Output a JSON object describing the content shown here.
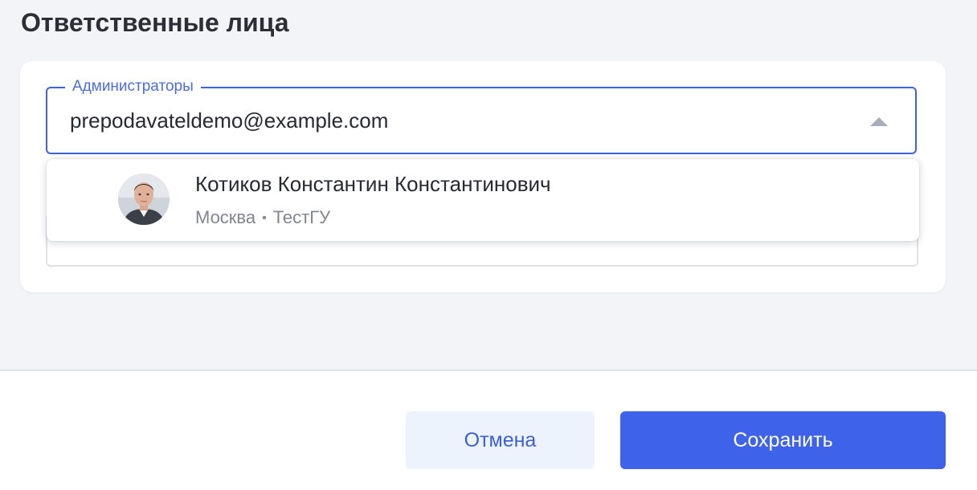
{
  "section": {
    "title": "Ответственные лица"
  },
  "admins_field": {
    "label": "Администраторы",
    "value": "prepodavateldemo@example.com",
    "caret_icon": "caret-up-icon"
  },
  "dropdown": {
    "options": [
      {
        "name": "Котиков Константин Константинович",
        "city": "Москва",
        "separator": "•",
        "organization": "ТестГУ",
        "avatar_icon": "user-avatar"
      }
    ]
  },
  "footer": {
    "cancel_label": "Отмена",
    "save_label": "Сохранить"
  },
  "colors": {
    "accent": "#3e62ea",
    "cancel_bg": "#edf3fc",
    "field_border": "#3d63e5",
    "page_bg": "#f2f4f8"
  }
}
